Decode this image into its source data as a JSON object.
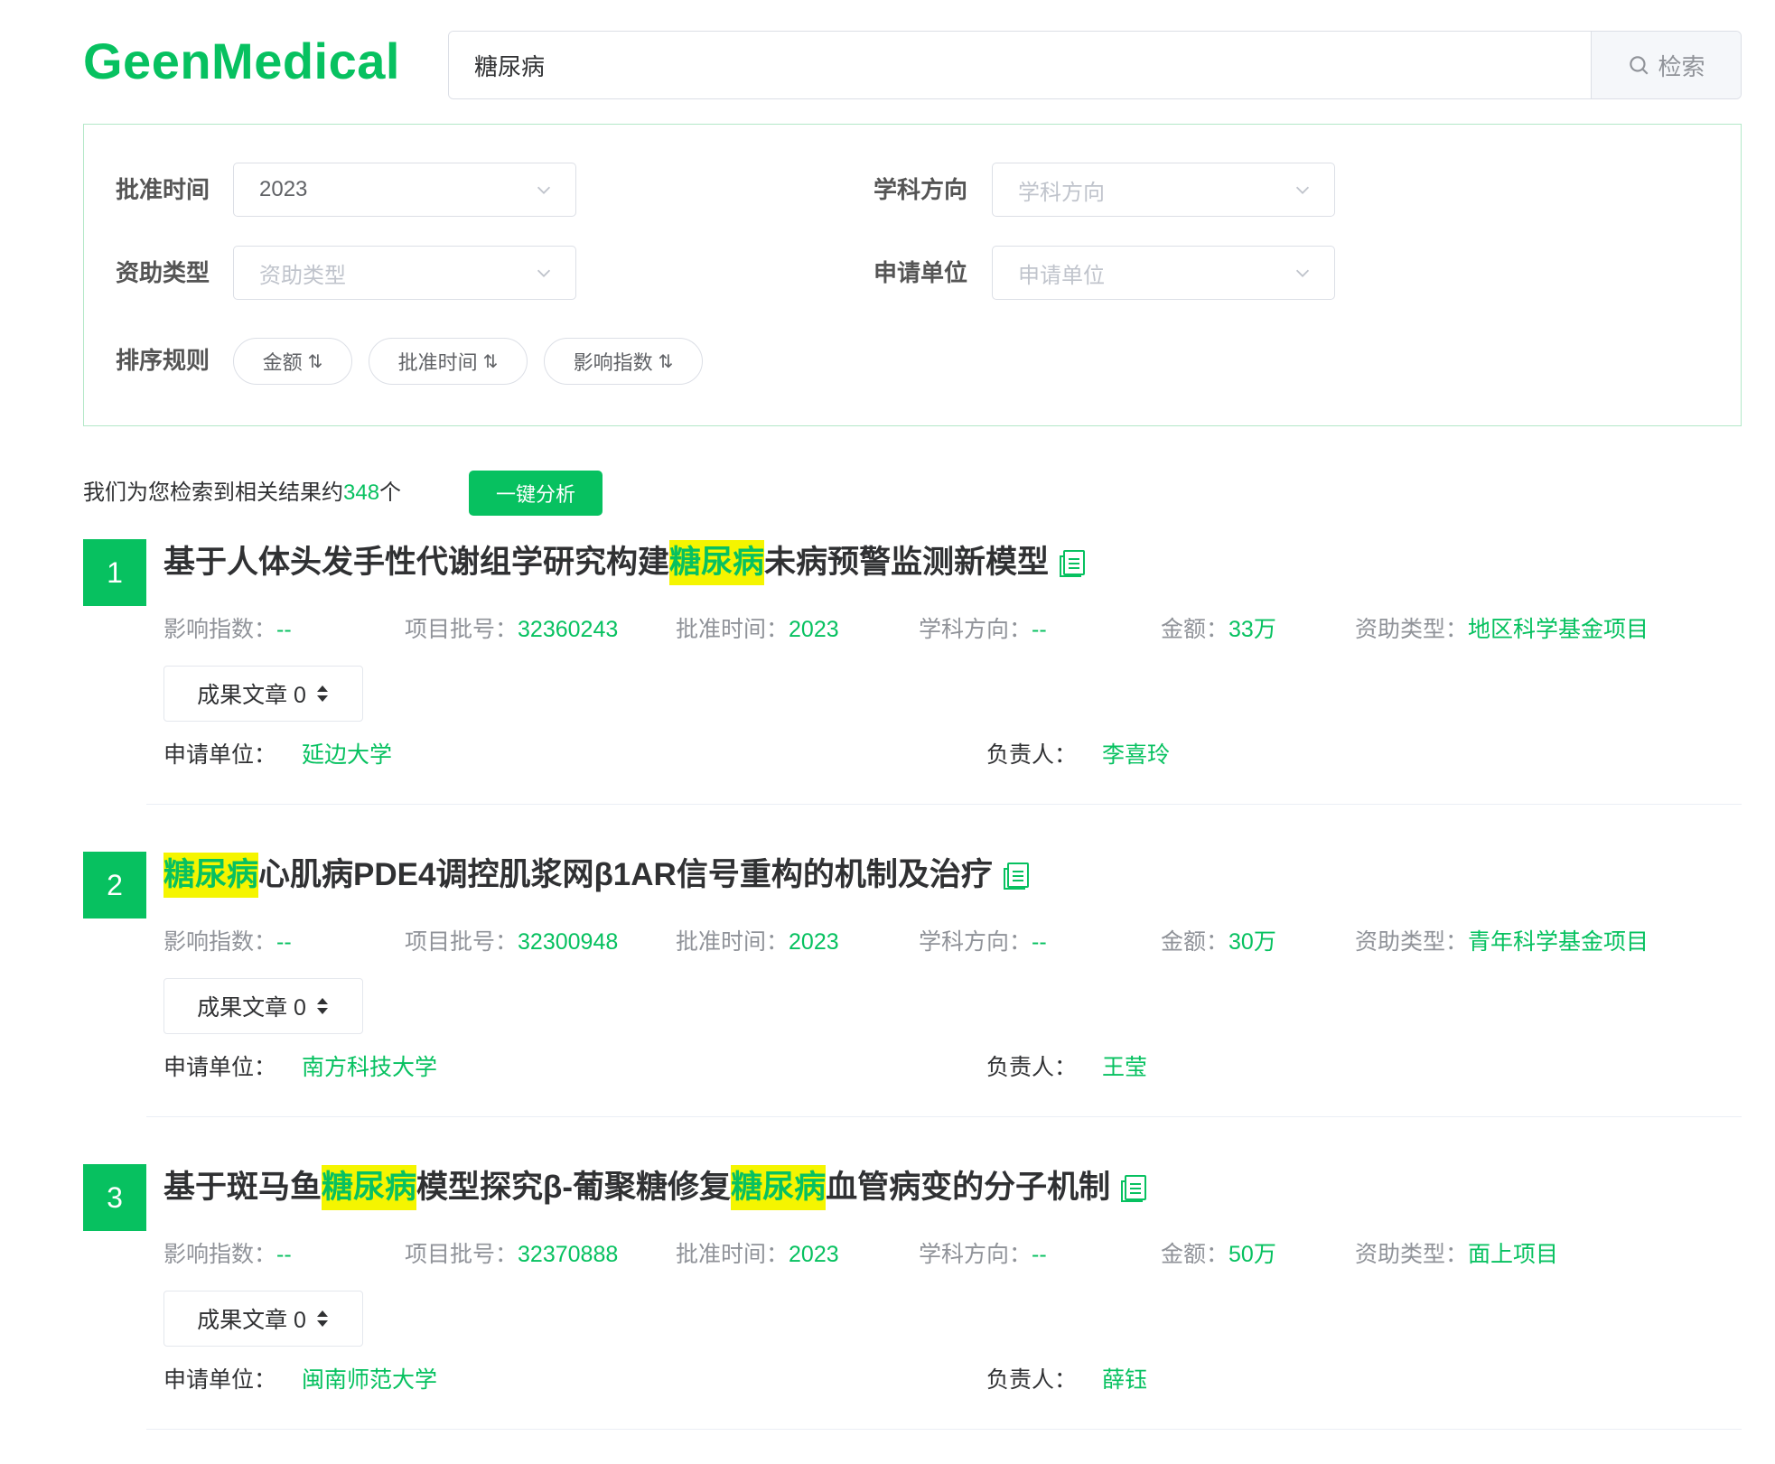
{
  "brand": {
    "name": "GeenMedical"
  },
  "search": {
    "value": "糖尿病",
    "button_label": "检索"
  },
  "filters": {
    "approval_time": {
      "label": "批准时间",
      "value": "2023"
    },
    "subject": {
      "label": "学科方向",
      "placeholder": "学科方向"
    },
    "funding_type": {
      "label": "资助类型",
      "placeholder": "资助类型"
    },
    "institution": {
      "label": "申请单位",
      "placeholder": "申请单位"
    },
    "sort": {
      "label": "排序规则",
      "options": [
        "金额",
        "批准时间",
        "影响指数"
      ]
    }
  },
  "summary": {
    "prefix": "我们为您检索到相关结果约",
    "count": "348",
    "suffix": "个",
    "analyze_label": "一键分析"
  },
  "labels": {
    "impact": "影响指数：",
    "project_no": "项目批号：",
    "approval": "批准时间：",
    "subject": "学科方向：",
    "amount": "金额：",
    "funding": "资助类型：",
    "articles": "成果文章 0",
    "institution": "申请单位：",
    "leader": "负责人："
  },
  "results": [
    {
      "num": "1",
      "title_parts": [
        "基于人体头发手性代谢组学研究构建",
        "糖尿病",
        "未病预警监测新模型"
      ],
      "impact": "--",
      "project_no": "32360243",
      "approval": "2023",
      "subject": "--",
      "amount": "33万",
      "funding": "地区科学基金项目",
      "institution": "延边大学",
      "leader": "李喜玲"
    },
    {
      "num": "2",
      "title_parts": [
        "",
        "糖尿病",
        "心肌病PDE4调控肌浆网β1AR信号重构的机制及治疗"
      ],
      "impact": "--",
      "project_no": "32300948",
      "approval": "2023",
      "subject": "--",
      "amount": "30万",
      "funding": "青年科学基金项目",
      "institution": "南方科技大学",
      "leader": "王莹"
    },
    {
      "num": "3",
      "title_parts": [
        "基于斑马鱼",
        "糖尿病",
        "模型探究β-葡聚糖修复",
        "糖尿病",
        "血管病变的分子机制"
      ],
      "impact": "--",
      "project_no": "32370888",
      "approval": "2023",
      "subject": "--",
      "amount": "50万",
      "funding": "面上项目",
      "institution": "闽南师范大学",
      "leader": "薛钰"
    }
  ]
}
